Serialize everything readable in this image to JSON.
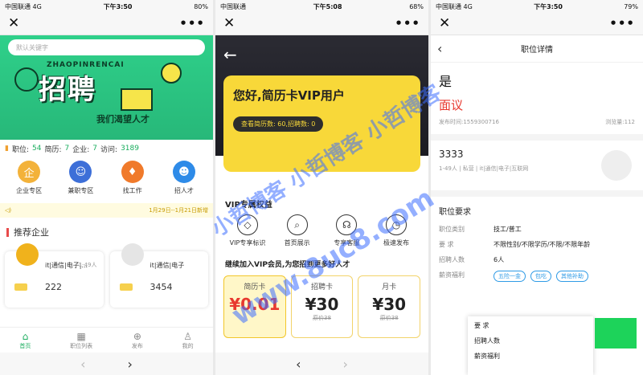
{
  "panel1": {
    "status": {
      "carrier": "中国联通",
      "network": "4G",
      "time": "下午3:50",
      "battery": "80%"
    },
    "search_placeholder": "默认关键字",
    "banner": {
      "title": "招聘",
      "pinyin": "ZHAOPINRENCAI",
      "slogan": "我们渴望人才"
    },
    "stats": {
      "jobs_label": "职位:",
      "jobs": "54",
      "resumes_label": "简历:",
      "resumes": "7",
      "companies_label": "企业:",
      "companies": "7",
      "visits_label": "访问:",
      "visits": "3189"
    },
    "categories": [
      "企业专区",
      "兼职专区",
      "找工作",
      "招人才"
    ],
    "notice": "1月29日--1月21日新增",
    "section_title": "推荐企业",
    "cards": [
      {
        "industry": "it|通信|电子|...",
        "size": "1-49人",
        "count": "222"
      },
      {
        "industry": "it|通信|电子",
        "size": "",
        "count": "3454"
      }
    ],
    "tabs": [
      "首页",
      "职位列表",
      "发布",
      "我的"
    ]
  },
  "panel2": {
    "status": {
      "carrier": "中国联通",
      "network": "",
      "time": "下午5:08",
      "battery": "68%"
    },
    "hello": "您好,简历卡VIP用户",
    "quota": "查看简历数: 60,招聘数: 0",
    "benefits_title": "VIP专属权益",
    "benefits": [
      "VIP专享标识",
      "首页展示",
      "专享客服",
      "极速发布"
    ],
    "cta": "继续加入VIP会员,为您招到更多好人才",
    "plans": [
      {
        "name": "简历卡",
        "price": "¥0.01",
        "orig": ""
      },
      {
        "name": "招聘卡",
        "price": "¥30",
        "orig": "原价38"
      },
      {
        "name": "月卡",
        "price": "¥30",
        "orig": "原价38"
      }
    ]
  },
  "panel3": {
    "status": {
      "carrier": "中国联通",
      "network": "4G",
      "time": "下午3:50",
      "battery": "79%"
    },
    "page_title": "职位详情",
    "job_title": "是",
    "salary": "面议",
    "publish_time": "发布时间:1559300716",
    "views": "浏览量:112",
    "company": {
      "name": "3333",
      "meta": "1-49人  |  私营  |  it|通信|电子|互联网"
    },
    "requirements_title": "职位要求",
    "rows": [
      {
        "k": "职位类别",
        "v": "技工/普工"
      },
      {
        "k": "要    求",
        "v": "不限性别/不限学历/不限/不限年龄"
      },
      {
        "k": "招聘人数",
        "v": "6人"
      }
    ],
    "benefits_label": "薪资福利",
    "benefits": [
      "五险一金",
      "包吃",
      "其他补助"
    ],
    "popup_rows": [
      "要    求",
      "招聘人数",
      "薪资福利"
    ]
  },
  "watermark": [
    "小哲博客 小哲博客 小哲博客",
    "www.8uc8.com"
  ],
  "colors": {
    "accent_green": "#1aad5e",
    "vip_yellow": "#f8d839",
    "salary_red": "#e8392f"
  }
}
